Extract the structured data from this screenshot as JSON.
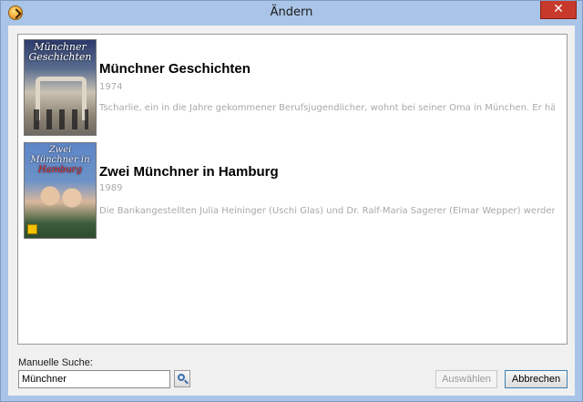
{
  "window": {
    "title": "Ändern",
    "close_glyph": "✕"
  },
  "results": [
    {
      "title": "Münchner Geschichten",
      "year": "1974",
      "description": "Tscharlie, ein in die Jahre gekommener Berufsjugendlicher, wohnt bei seiner Oma in München. Er hält vi...",
      "poster_text": [
        "Münchner",
        "Geschichten"
      ],
      "poster_icon": "movie-poster-icon"
    },
    {
      "title": "Zwei Münchner in Hamburg",
      "year": "1989",
      "description": "Die Bankangestellten Julia Heininger (Uschi Glas) und Dr. Ralf-Maria Sagerer (Elmar Wepper) werden ge...",
      "poster_text": [
        "Zwei",
        "Münchner in",
        "Hamburg"
      ],
      "poster_icon": "movie-poster-icon"
    }
  ],
  "search": {
    "label": "Manuelle Suche:",
    "value": "Münchner",
    "button_icon": "search-icon"
  },
  "buttons": {
    "select": "Auswählen",
    "cancel": "Abbrechen"
  },
  "colors": {
    "title_bar": "#a9c4e6",
    "close_button": "#c7392b",
    "secondary_text": "#a8a8a8"
  }
}
